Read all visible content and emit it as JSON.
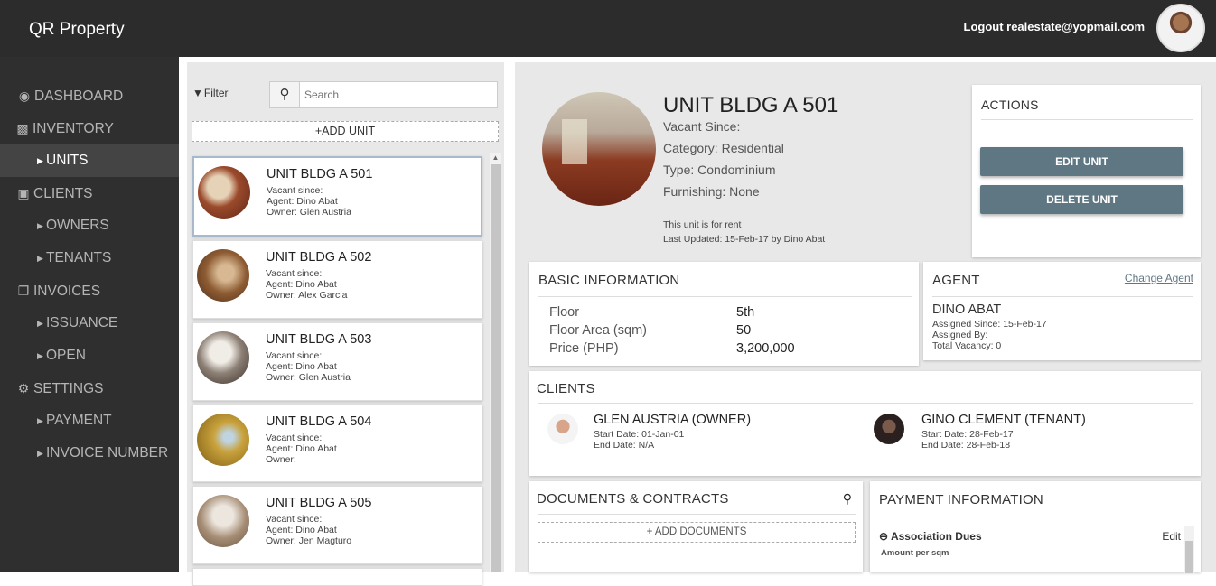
{
  "header": {
    "brand": "QR Property",
    "logout": "Logout realestate@yopmail.com"
  },
  "sidebar": {
    "items": [
      {
        "label": "DASHBOARD",
        "icon": "palette-icon",
        "glyph": "🎨"
      },
      {
        "label": "INVENTORY",
        "icon": "sitemap-icon",
        "glyph": "⚙"
      },
      {
        "label": "UNITS",
        "icon": "chevron-right-icon",
        "glyph": "▶"
      },
      {
        "label": "CLIENTS",
        "icon": "id-card-icon",
        "glyph": "▣"
      },
      {
        "label": "OWNERS",
        "icon": "chevron-right-icon",
        "glyph": "▶"
      },
      {
        "label": "TENANTS",
        "icon": "chevron-right-icon",
        "glyph": "▶"
      },
      {
        "label": "INVOICES",
        "icon": "copy-icon",
        "glyph": "❐"
      },
      {
        "label": "ISSUANCE",
        "icon": "chevron-right-icon",
        "glyph": "▶"
      },
      {
        "label": "OPEN",
        "icon": "chevron-right-icon",
        "glyph": "▶"
      },
      {
        "label": "SETTINGS",
        "icon": "gears-icon",
        "glyph": "⚙"
      },
      {
        "label": "PAYMENT",
        "icon": "chevron-right-icon",
        "glyph": "▶"
      },
      {
        "label": "INVOICE NUMBER",
        "icon": "chevron-right-icon",
        "glyph": "▶"
      }
    ]
  },
  "unit_list": {
    "filter_label": "Filter",
    "search_placeholder": "Search",
    "add_unit": "+ADD UNIT",
    "units": [
      {
        "name": "UNIT BLDG A 501",
        "vacant": "Vacant since:",
        "agent": "Agent: Dino Abat",
        "owner": "Owner: Glen Austria"
      },
      {
        "name": "UNIT BLDG A 502",
        "vacant": "Vacant since:",
        "agent": "Agent: Dino Abat",
        "owner": "Owner: Alex Garcia"
      },
      {
        "name": "UNIT BLDG A 503",
        "vacant": "Vacant since:",
        "agent": "Agent: Dino Abat",
        "owner": "Owner: Glen Austria"
      },
      {
        "name": "UNIT BLDG A 504",
        "vacant": "Vacant since:",
        "agent": "Agent: Dino Abat",
        "owner": "Owner:"
      },
      {
        "name": "UNIT BLDG A 505",
        "vacant": "Vacant since:",
        "agent": "Agent: Dino Abat",
        "owner": "Owner: Jen Magturo"
      }
    ]
  },
  "detail": {
    "title": "UNIT BLDG A 501",
    "vacant_since": "Vacant Since:",
    "category": "Category: Residential",
    "type": "Type: Condominium",
    "furnishing": "Furnishing: None",
    "rent_note": "This unit is for rent",
    "last_updated": "Last Updated: 15-Feb-17 by Dino Abat"
  },
  "actions": {
    "title": "ACTIONS",
    "edit": "EDIT UNIT",
    "delete": "DELETE UNIT"
  },
  "basic_info": {
    "title": "BASIC INFORMATION",
    "rows": [
      {
        "label": "Floor",
        "value": "5th"
      },
      {
        "label": "Floor Area (sqm)",
        "value": "50"
      },
      {
        "label": "Price (PHP)",
        "value": "3,200,000"
      }
    ]
  },
  "agent": {
    "title": "AGENT",
    "change": "Change Agent",
    "name": "DINO ABAT",
    "assigned_since": "Assigned Since: 15-Feb-17",
    "assigned_by": "Assigned By:",
    "total_vacancy": "Total Vacancy: 0"
  },
  "clients": {
    "title": "CLIENTS",
    "items": [
      {
        "name": "GLEN AUSTRIA (OWNER)",
        "start": "Start Date: 01-Jan-01",
        "end": "End Date: N/A"
      },
      {
        "name": "GINO CLEMENT (TENANT)",
        "start": "Start Date: 28-Feb-17",
        "end": "End Date: 28-Feb-18"
      }
    ]
  },
  "documents": {
    "title": "DOCUMENTS & CONTRACTS",
    "add": "+ ADD DOCUMENTS"
  },
  "payment": {
    "title": "PAYMENT INFORMATION",
    "section": "Association Dues",
    "edit": "Edit",
    "amount_label": "Amount per sqm"
  }
}
